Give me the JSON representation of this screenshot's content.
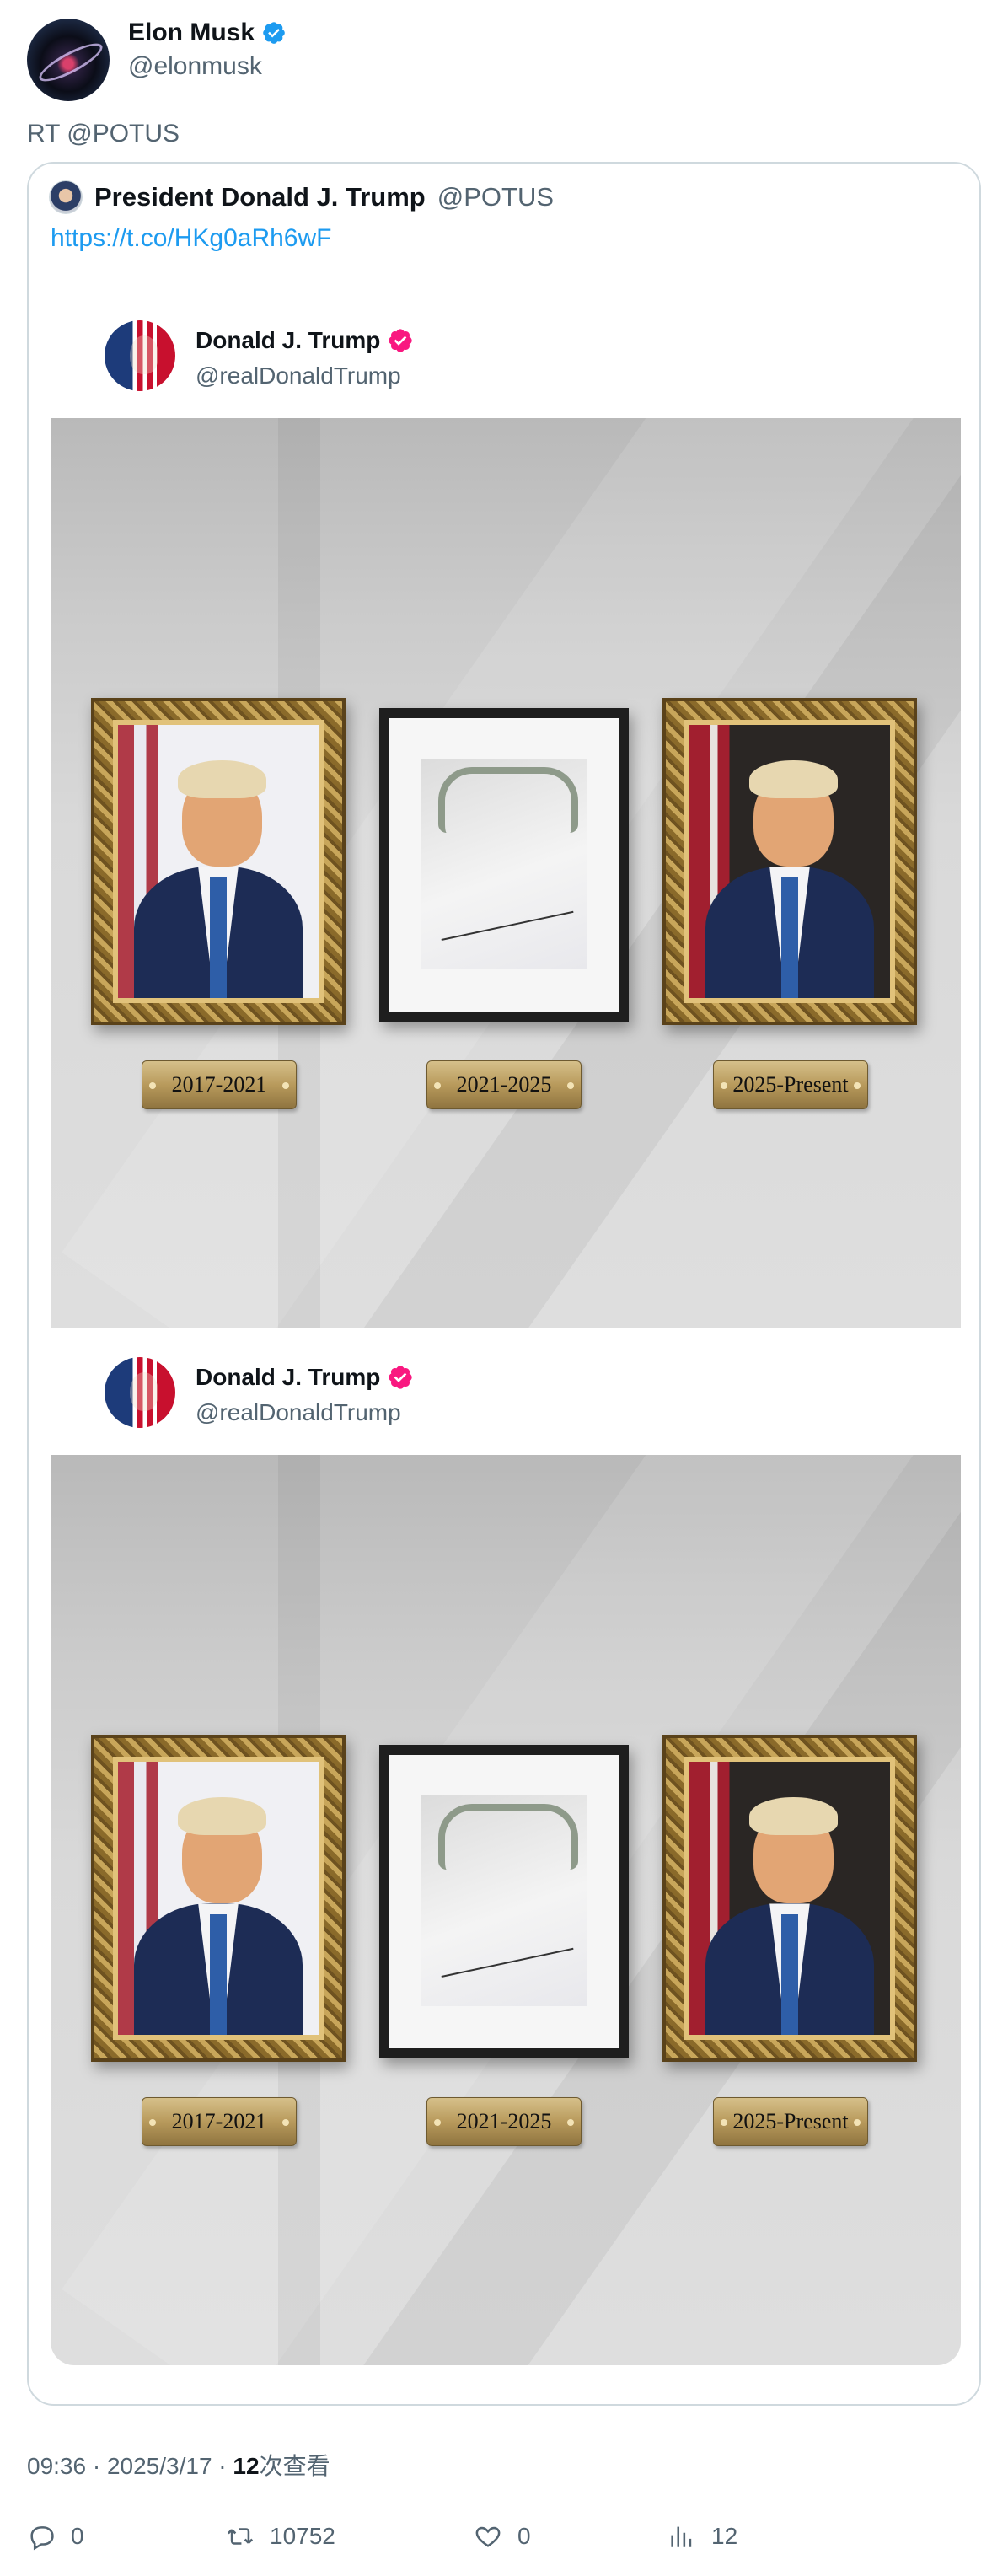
{
  "author": {
    "name": "Elon Musk",
    "handle": "@elonmusk",
    "verified_color": "#1d9bf0"
  },
  "retweet_text": "RT @POTUS",
  "quote": {
    "name": "President Donald J. Trump",
    "handle": "@POTUS",
    "link": "https://t.co/HKg0aRh6wF",
    "embedded_posts": [
      {
        "name": "Donald J. Trump",
        "handle": "@realDonaldTrump",
        "verified_color": "#f91880",
        "plaques": [
          "2017-2021",
          "2021-2025",
          "2025-Present"
        ]
      },
      {
        "name": "Donald J. Trump",
        "handle": "@realDonaldTrump",
        "verified_color": "#f91880",
        "plaques": [
          "2017-2021",
          "2021-2025",
          "2025-Present"
        ]
      }
    ]
  },
  "meta": {
    "time_date": "09:36 · 2025/3/17 · ",
    "views_count": "12",
    "views_label": "次查看"
  },
  "actions": {
    "reply": {
      "icon": "reply-icon",
      "count": "0"
    },
    "retweet": {
      "icon": "retweet-icon",
      "count": "10752"
    },
    "like": {
      "icon": "heart-icon",
      "count": "0"
    },
    "views": {
      "icon": "analytics-icon",
      "count": "12"
    }
  }
}
